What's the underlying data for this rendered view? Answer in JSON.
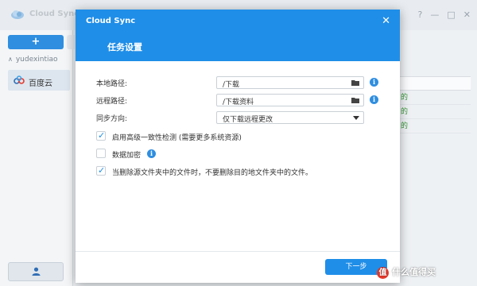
{
  "background_app": {
    "title": "Cloud Sync",
    "window_controls": [
      "?",
      "—",
      "□",
      "✕"
    ],
    "add_button_label": "+",
    "account": "yudexintiao",
    "connections": [
      {
        "label": "百度云",
        "icon": "baidu-cloud-icon"
      }
    ],
    "status_column": [
      "的",
      "的",
      "的"
    ]
  },
  "dialog": {
    "app_name": "Cloud Sync",
    "close_label": "✕",
    "title": "任务设置",
    "local_path": {
      "label": "本地路径:",
      "value": "/下载"
    },
    "remote_path": {
      "label": "远程路径:",
      "value": "/下载资料"
    },
    "sync_direction": {
      "label": "同步方向:",
      "value": "仅下载远程更改"
    },
    "options": [
      {
        "label": "启用高级一致性检测 (需要更多系统资源)",
        "checked": true,
        "has_info": false
      },
      {
        "label": "数据加密",
        "checked": false,
        "has_info": true
      },
      {
        "label": "当删除源文件夹中的文件时，不要删除目的地文件夹中的文件。",
        "checked": true,
        "has_info": false
      }
    ],
    "next_button": "下一步"
  },
  "watermark": {
    "badge": "值",
    "text": "什么值得买"
  },
  "colors": {
    "accent": "#1f8ee8",
    "status_green": "#3a9a3a",
    "sidebar_selected": "#dde6ef"
  }
}
